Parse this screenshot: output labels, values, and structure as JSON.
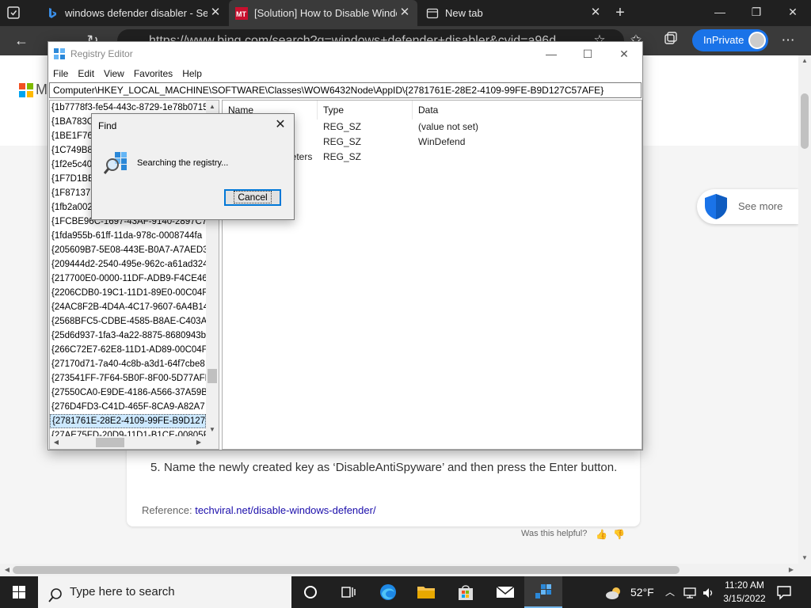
{
  "browser": {
    "tabs": [
      {
        "title": "windows defender disabler - Sea",
        "favicon": "bing-icon",
        "active": false
      },
      {
        "title": "[Solution] How to Disable Windo",
        "favicon": "minitool-icon",
        "active": true
      },
      {
        "title": "New tab",
        "favicon": "newtab-page-icon",
        "active": false
      }
    ],
    "address": "https://www.bing.com/search?q=windows+defender+disabler&cvid=a96d",
    "inprivate_label": "InPrivate",
    "accent_color": "#1a73e8"
  },
  "page": {
    "logo_letter": "M",
    "see_more": "See more",
    "step_number": "5.",
    "step_text": "Name the newly created key as ‘DisableAntiSpyware’ and then press the Enter button.",
    "reference_label": "Reference:",
    "reference_link": "techviral.net/disable-windows-defender/",
    "helpful": "Was this helpful?"
  },
  "regedit": {
    "title": "Registry Editor",
    "menu": [
      "File",
      "Edit",
      "View",
      "Favorites",
      "Help"
    ],
    "path": "Computer\\HKEY_LOCAL_MACHINE\\SOFTWARE\\Classes\\WOW6432Node\\AppID\\{2781761E-28E2-4109-99FE-B9D127C57AFE}",
    "tree_items": [
      "{1b7778f3-fe54-443c-8729-1e78b0715",
      "{1BA783C",
      "{1BE1F766",
      "{1C749B87",
      "{1f2e5c40-",
      "{1F7D1BE9",
      "{1F87137D",
      "{1fb2a002",
      "{1FCBE96C-1697-43AF-9140-2897C7C",
      "{1fda955b-61ff-11da-978c-0008744fa",
      "{205609B7-5E08-443E-B0A7-A7AED3F",
      "{209444d2-2540-495e-962c-a61ad324",
      "{217700E0-0000-11DF-ADB9-F4CE462",
      "{2206CDB0-19C1-11D1-89E0-00C04FI",
      "{24AC8F2B-4D4A-4C17-9607-6A4B14",
      "{2568BFC5-CDBE-4585-B8AE-C403A2",
      "{25d6d937-1fa3-4a22-8875-8680943b",
      "{266C72E7-62E8-11D1-AD89-00C04FI",
      "{27170d71-7a40-4c8b-a3d1-64f7cbe8",
      "{273541FF-7F64-5B0F-8F00-5D77AFB",
      "{27550CA0-E9DE-4186-A566-37A59BI",
      "{276D4FD3-C41D-465F-8CA9-A82A7",
      "{2781761E-28E2-4109-99FE-B9D127C",
      "{27AE75FD-20D9-11D1-B1CE-00805F"
    ],
    "selected_index": 22,
    "columns": [
      "Name",
      "Type",
      "Data"
    ],
    "rows": [
      {
        "name": "",
        "type": "REG_SZ",
        "data": "(value not set)"
      },
      {
        "name": "",
        "type": "REG_SZ",
        "data": "WinDefend"
      },
      {
        "name": "neters",
        "type": "REG_SZ",
        "data": ""
      }
    ]
  },
  "find_dialog": {
    "title": "Find",
    "message": "Searching the registry...",
    "cancel": "Cancel"
  },
  "taskbar": {
    "search_placeholder": "Type here to search",
    "weather": "52°F",
    "time": "11:20 AM",
    "date": "3/15/2022"
  }
}
